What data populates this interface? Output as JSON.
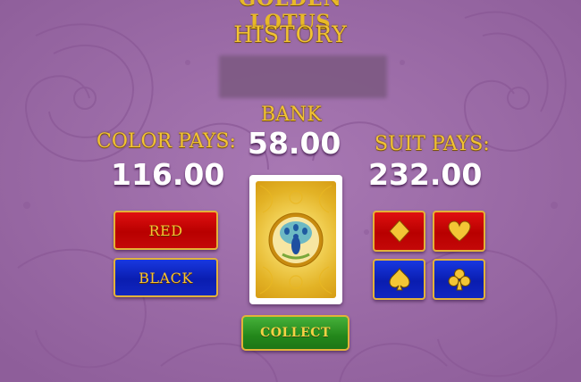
{
  "header": {
    "logo_text": "GOLDEN LOTUS",
    "history_title": "HISTORY"
  },
  "bank": {
    "label": "BANK",
    "value": "58.00"
  },
  "color_pays": {
    "label": "COLOR PAYS:",
    "value": "116.00"
  },
  "suit_pays": {
    "label": "SUIT PAYS:",
    "value": "232.00"
  },
  "color_buttons": [
    {
      "label": "RED"
    },
    {
      "label": "BLACK"
    }
  ],
  "suit_buttons": [
    {
      "suit": "diamonds",
      "icon": "diamond-icon",
      "color": "red"
    },
    {
      "suit": "hearts",
      "icon": "heart-icon",
      "color": "red"
    },
    {
      "suit": "spades",
      "icon": "spade-icon",
      "color": "blue"
    },
    {
      "suit": "clubs",
      "icon": "club-icon",
      "color": "blue"
    }
  ],
  "card": {
    "state": "face-down",
    "back_motif": "peacock"
  },
  "collect_button": {
    "label": "COLLECT"
  },
  "colors": {
    "background": "#9a6aa6",
    "gold": "#f2c332",
    "red_button": "#c40808",
    "blue_button": "#1126c0",
    "green_button": "#23871b"
  }
}
